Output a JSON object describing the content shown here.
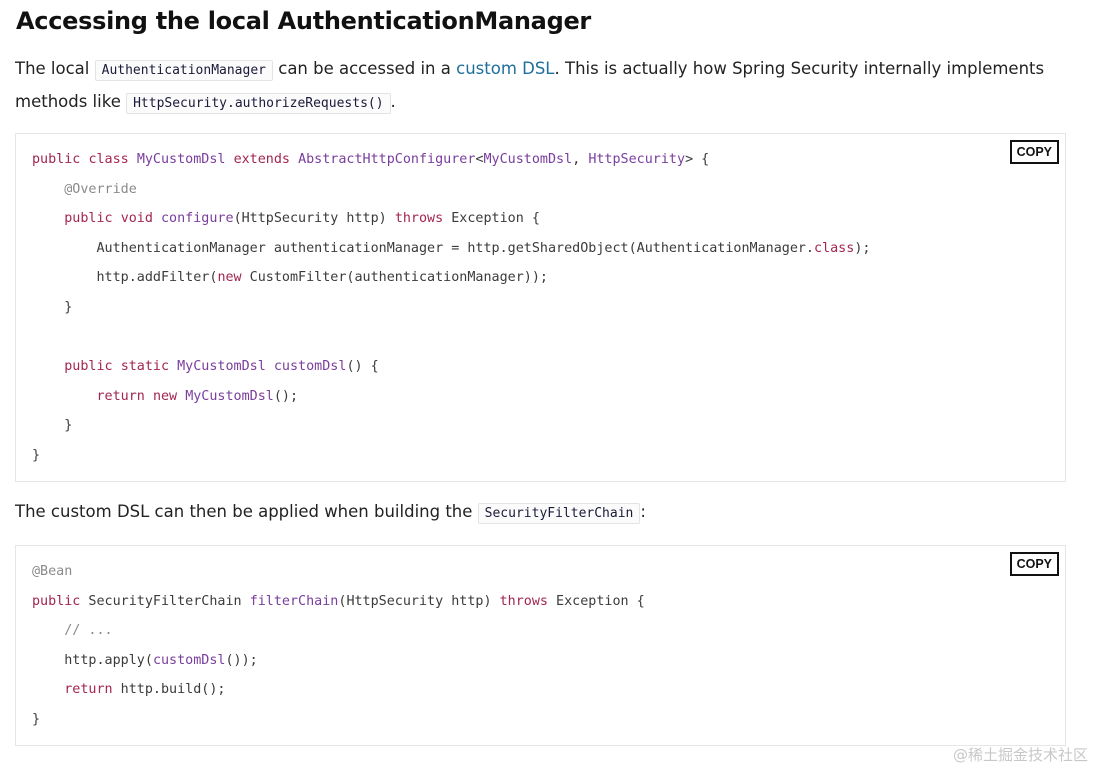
{
  "title": "Accessing the local AuthenticationManager",
  "intro": {
    "text_before": "The local ",
    "code_1": "AuthenticationManager",
    "text_mid": " can be accessed in a ",
    "link": "custom DSL",
    "text_after": ". This is actually how Spring Security internally implements methods like ",
    "code_2": "HttpSecurity.authorizeRequests()",
    "text_end": "."
  },
  "code_block_1": {
    "copy_label": "COPY",
    "lines": [
      "public class MyCustomDsl extends AbstractHttpConfigurer<MyCustomDsl, HttpSecurity> {",
      "    @Override",
      "    public void configure(HttpSecurity http) throws Exception {",
      "        AuthenticationManager authenticationManager = http.getSharedObject(AuthenticationManager.class);",
      "        http.addFilter(new CustomFilter(authenticationManager));",
      "    }",
      "",
      "    public static MyCustomDsl customDsl() {",
      "        return new MyCustomDsl();",
      "    }",
      "}"
    ]
  },
  "middle": {
    "text_before": "The custom DSL can then be applied when building the ",
    "code": "SecurityFilterChain",
    "text_after": ":"
  },
  "code_block_2": {
    "copy_label": "COPY",
    "lines": [
      "@Bean",
      "public SecurityFilterChain filterChain(HttpSecurity http) throws Exception {",
      "    // ...",
      "    http.apply(customDsl());",
      "    return http.build();",
      "}"
    ]
  },
  "watermark": "@稀土掘金技术社区",
  "colors": {
    "keyword": "#a3264f",
    "type": "#7a3e9d",
    "link": "#1f6f9c"
  }
}
